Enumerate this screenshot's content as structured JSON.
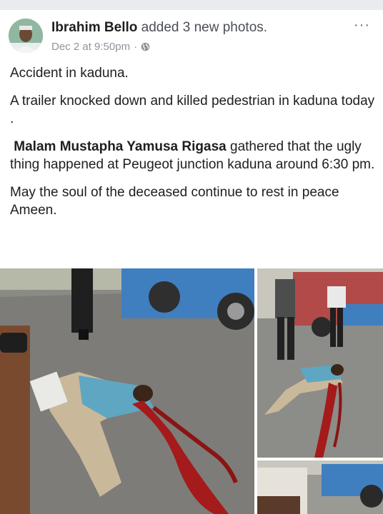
{
  "post": {
    "author": "Ibrahim Bello",
    "action": "added 3 new photos.",
    "timestamp": "Dec 2 at 9:50pm",
    "separator": "·",
    "privacy_icon": "globe-icon",
    "more_icon": "more-options-icon",
    "more_label": "···"
  },
  "body": {
    "p1": "Accident in kaduna.",
    "p2": "A trailer knocked down and killed pedestrian in kaduna today .",
    "p3_bold": "Malam Mustapha Yamusa Rigasa",
    "p3_rest": " gathered that the ugly thing happened at Peugeot junction kaduna around 6:30 pm.",
    "p4": "May the soul of the deceased continue to rest in peace Ameen."
  },
  "colors": {
    "text": "#1c1e21",
    "secondary": "#90949c",
    "background": "#ffffff"
  }
}
